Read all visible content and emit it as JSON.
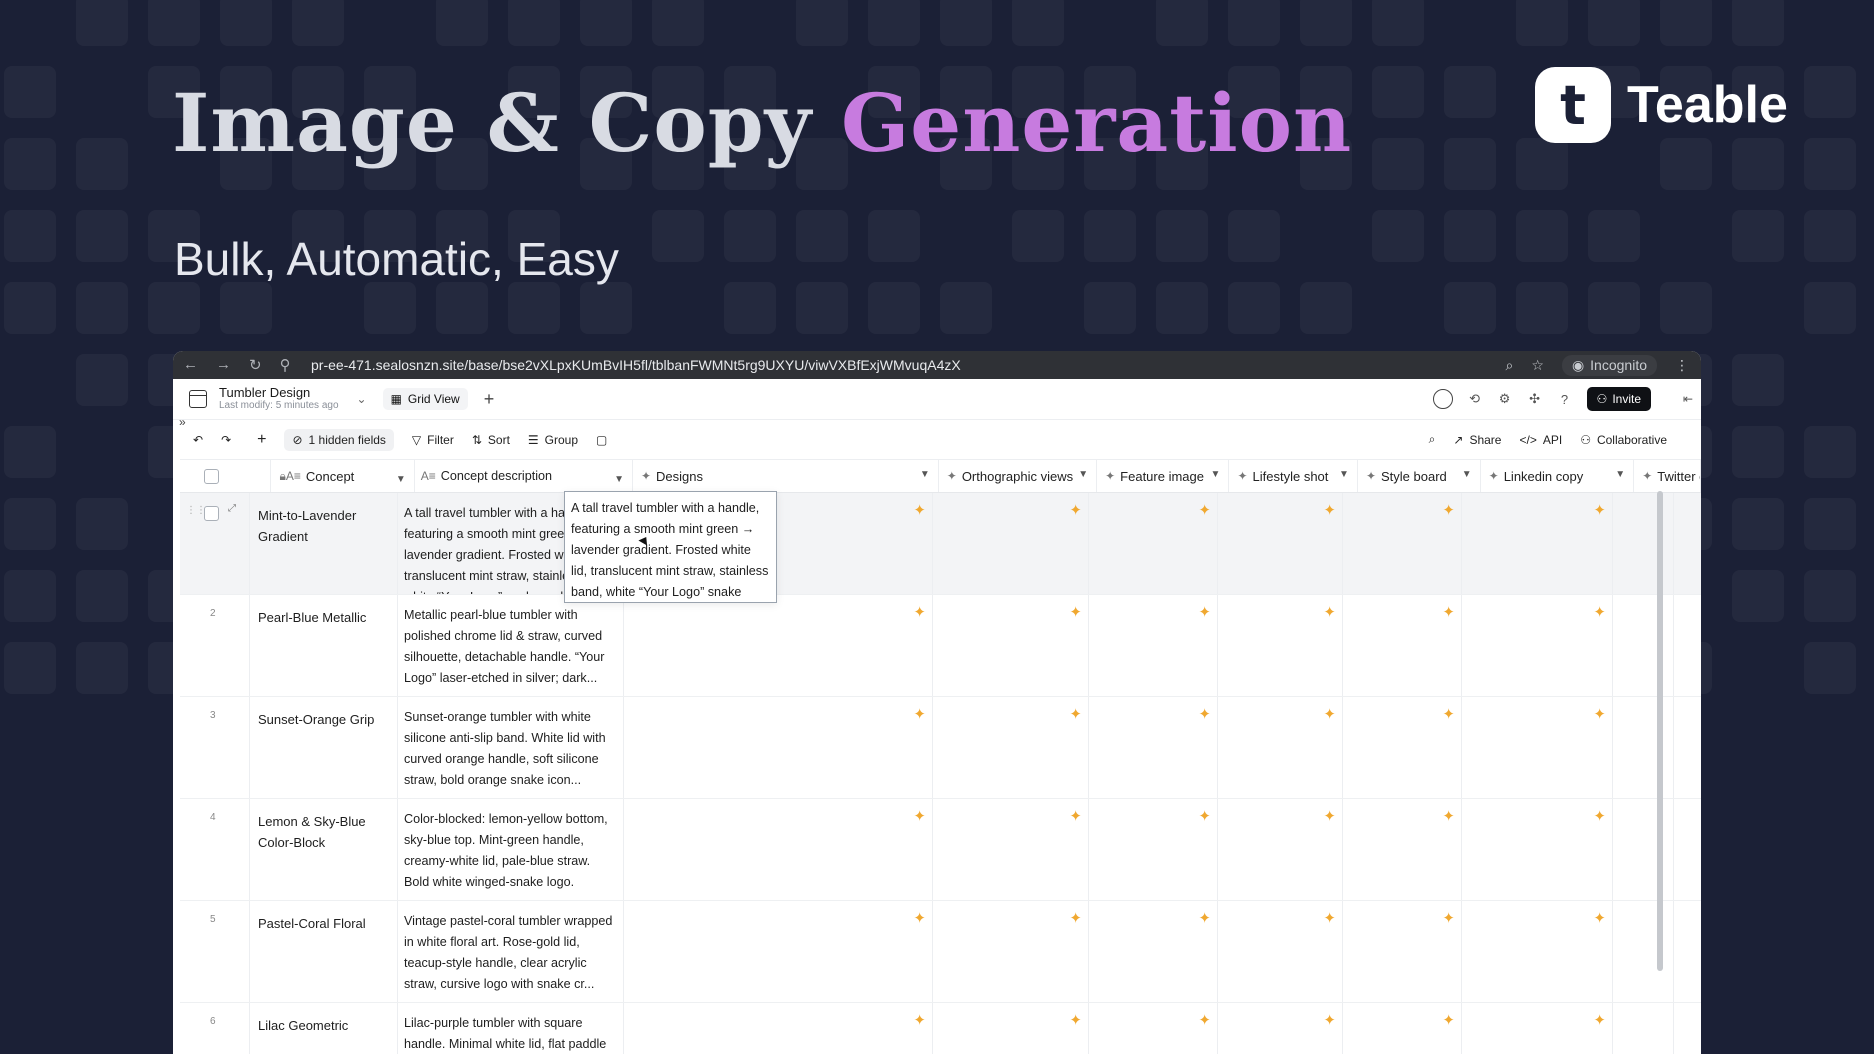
{
  "hero": {
    "title_main": "Image & Copy",
    "title_accent": "Generation",
    "subtitle": "Bulk, Automatic, Easy",
    "brand_mark": "t",
    "brand_name": "Teable",
    "accent_color": "#c77bdf"
  },
  "browser": {
    "url": "pr-ee-471.sealosnzn.site/base/bse2vXLpxKUmBvIH5fl/tblbanFWMNt5rg9UXYU/viwVXBfExjWMvuqA4zX",
    "mode_label": "Incognito"
  },
  "app": {
    "table_name": "Tumbler Design",
    "last_modified": "Last modify: 5 minutes ago",
    "view_label": "Grid View",
    "invite_label": "Invite",
    "toolbar": {
      "hidden_fields": "1 hidden fields",
      "filter": "Filter",
      "sort": "Sort",
      "group": "Group",
      "share": "Share",
      "api": "API",
      "collaborative": "Collaborative"
    }
  },
  "grid": {
    "columns": [
      "Concept",
      "Concept description",
      "Designs",
      "Orthographic views",
      "Feature image",
      "Lifestyle shot",
      "Style board",
      "Linkedin copy",
      "Twitter co"
    ],
    "rows": [
      {
        "num": "1",
        "concept": "Mint-to-Lavender Gradient",
        "description": "A tall travel tumbler with a handle, featuring a smooth mint green → lavender gradient. Frosted white lid, translucent mint straw, stainless band, white “Your Logo” snake emble"
      },
      {
        "num": "2",
        "concept": "Pearl-Blue Metallic",
        "description": "Metallic pearl-blue tumbler with polished chrome lid & straw, curved silhouette, detachable handle. “Your Logo” laser-etched in silver; dark..."
      },
      {
        "num": "3",
        "concept": "Sunset-Orange Grip",
        "description": "Sunset-orange tumbler with white silicone anti-slip band. White lid with curved orange handle, soft silicone straw, bold orange snake icon..."
      },
      {
        "num": "4",
        "concept": "Lemon & Sky-Blue Color-Block",
        "description": "Color-blocked: lemon-yellow bottom, sky-blue top. Mint-green handle, creamy-white lid, pale-blue straw. Bold white winged-snake logo."
      },
      {
        "num": "5",
        "concept": "Pastel-Coral Floral",
        "description": "Vintage pastel-coral tumbler wrapped in white floral art. Rose-gold lid, teacup-style handle, clear acrylic straw, cursive logo with snake cr..."
      },
      {
        "num": "6",
        "concept": "Lilac Geometric",
        "description": "Lilac-purple tumbler with square handle. Minimal white lid, flat paddle"
      }
    ]
  }
}
